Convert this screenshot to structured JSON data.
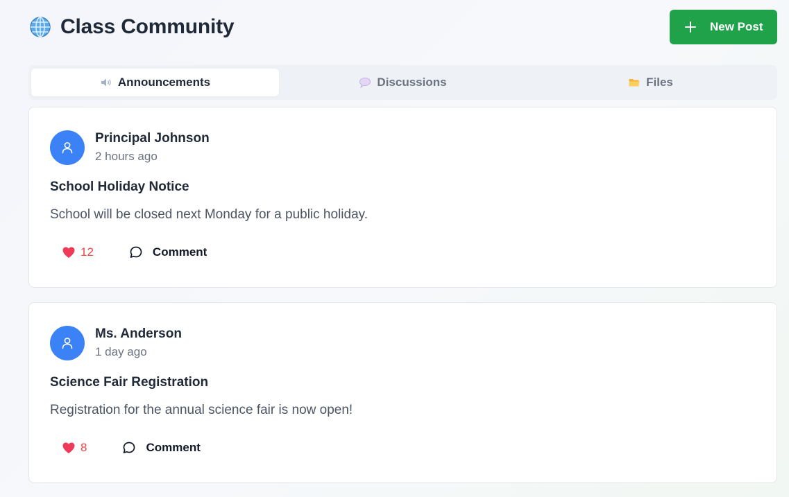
{
  "header": {
    "title": "Class Community",
    "title_icon": "globe-icon",
    "new_post_label": "New Post",
    "new_post_icon": "plus-icon",
    "accent_color": "#1fa24a"
  },
  "tabs": [
    {
      "label": "Announcements",
      "icon": "speaker-icon",
      "active": true
    },
    {
      "label": "Discussions",
      "icon": "speech-bubble-icon",
      "active": false
    },
    {
      "label": "Files",
      "icon": "folder-icon",
      "active": false
    }
  ],
  "posts": [
    {
      "author": "Principal Johnson",
      "time": "2 hours ago",
      "title": "School Holiday Notice",
      "body": "School will be closed next Monday for a public holiday.",
      "likes": "12",
      "comment_label": "Comment"
    },
    {
      "author": "Ms. Anderson",
      "time": "1 day ago",
      "title": "Science Fair Registration",
      "body": "Registration for the annual science fair is now open!",
      "likes": "8",
      "comment_label": "Comment"
    }
  ]
}
